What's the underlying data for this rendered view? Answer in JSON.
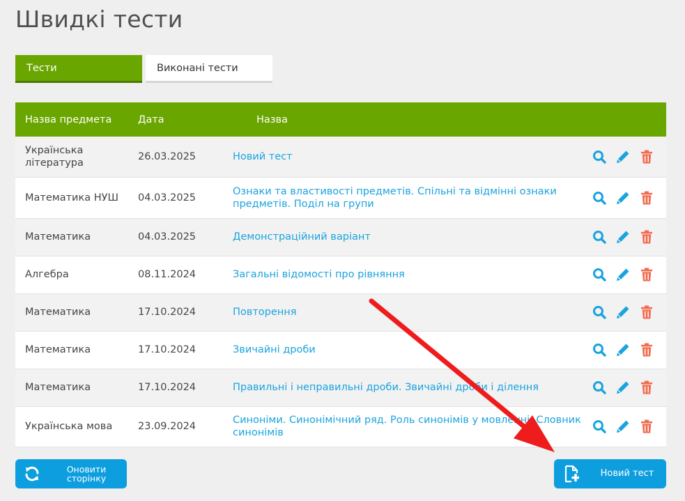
{
  "page": {
    "title": "Швидкі тести"
  },
  "tabs": [
    {
      "label": "Тести",
      "active": true
    },
    {
      "label": "Виконані тести",
      "active": false
    }
  ],
  "table": {
    "headers": {
      "subject": "Назва предмета",
      "date": "Дата",
      "name": "Назва"
    },
    "rows": [
      {
        "subject": "Українська література",
        "date": "26.03.2025",
        "name": "Новий тест"
      },
      {
        "subject": "Математика НУШ",
        "date": "04.03.2025",
        "name": "Ознаки та властивості предметів. Спільні та відмінні ознаки предметів. Поділ на групи"
      },
      {
        "subject": "Математика",
        "date": "04.03.2025",
        "name": "Демонстраційний варіант"
      },
      {
        "subject": "Алгебра",
        "date": "08.11.2024",
        "name": "Загальні відомості про рівняння"
      },
      {
        "subject": "Математика",
        "date": "17.10.2024",
        "name": "Повторення"
      },
      {
        "subject": "Математика",
        "date": "17.10.2024",
        "name": "Звичайні дроби"
      },
      {
        "subject": "Математика",
        "date": "17.10.2024",
        "name": "Правильні і неправильні дроби. Звичайні дроби і ділення"
      },
      {
        "subject": "Українська мова",
        "date": "23.09.2024",
        "name": "Синоніми. Синонімічний ряд. Роль синонімів у мовленні. Словник синонімів"
      }
    ],
    "row_actions": [
      "view-icon",
      "edit-icon",
      "delete-icon"
    ]
  },
  "buttons": {
    "refresh": {
      "label": "Оновити сторінку",
      "icon": "refresh-icon"
    },
    "new_test": {
      "label": "Новий тест",
      "icon": "new-document-icon"
    }
  },
  "colors": {
    "accent_green": "#6aa600",
    "link_blue": "#1aa3de",
    "button_blue": "#0d9ee0",
    "delete_red": "#f26b4f",
    "annotation_red": "#ee1c1c"
  }
}
